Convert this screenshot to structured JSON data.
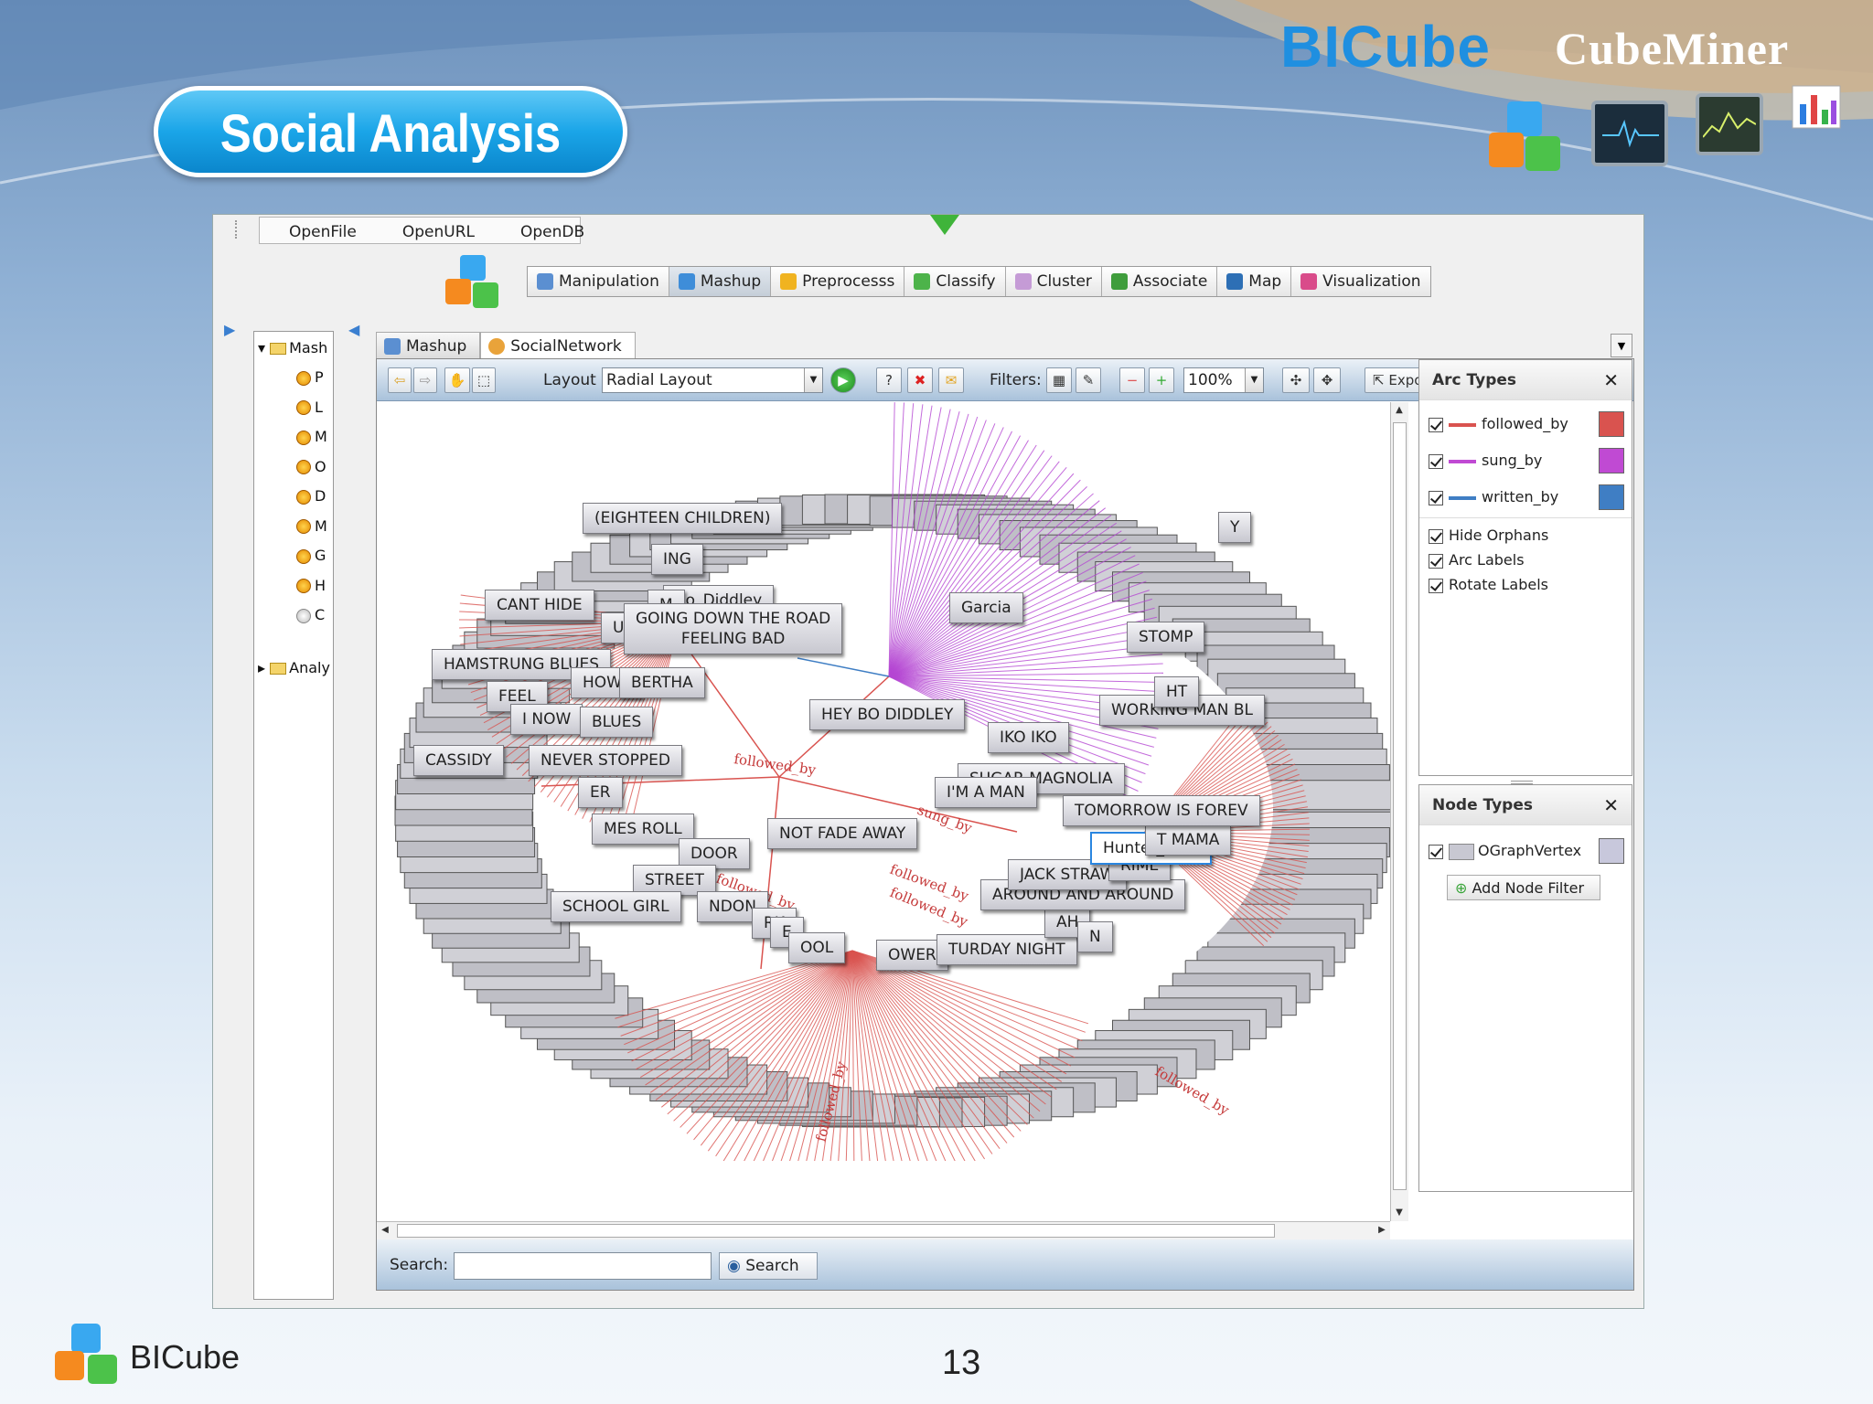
{
  "slide": {
    "brand_main": "BICube",
    "brand_sub": "CubeMiner",
    "title": "Social Analysis",
    "footer_brand": "BICube",
    "page_number": "13"
  },
  "menubar": [
    "OpenFile",
    "OpenURL",
    "OpenDB"
  ],
  "toolbar": [
    {
      "label": "Manipulation",
      "icon": "manipulation-icon",
      "color": "#5b8fd1"
    },
    {
      "label": "Mashup",
      "icon": "mashup-icon",
      "color": "#3e8dd9",
      "active": true
    },
    {
      "label": "Preprocesss",
      "icon": "gear-icon",
      "color": "#f0b320"
    },
    {
      "label": "Classify",
      "icon": "check-icon",
      "color": "#4db34a"
    },
    {
      "label": "Cluster",
      "icon": "cluster-icon",
      "color": "#c59bd6"
    },
    {
      "label": "Associate",
      "icon": "associate-icon",
      "color": "#3f9d3c"
    },
    {
      "label": "Map",
      "icon": "globe-icon",
      "color": "#2d6fb5"
    },
    {
      "label": "Visualization",
      "icon": "bar-chart-icon",
      "color": "#d94b8a"
    }
  ],
  "tree": {
    "root": "Mash",
    "items": [
      "P",
      "L",
      "M",
      "O",
      "D",
      "M",
      "G",
      "H",
      "C"
    ],
    "second_root": "Analy"
  },
  "tabs": [
    {
      "label": "Mashup",
      "icon": "mashup-icon"
    },
    {
      "label": "SocialNetwork",
      "icon": "network-icon"
    }
  ],
  "graph_toolbar": {
    "layout_label": "Layout",
    "layout_value": "Radial Layout",
    "filters_label": "Filters:",
    "zoom_value": "100%",
    "export_label": "Export..."
  },
  "search": {
    "label": "Search:",
    "value": "",
    "button": "Search"
  },
  "arc_types": {
    "title": "Arc Types",
    "items": [
      {
        "label": "followed_by",
        "color": "#d9534f"
      },
      {
        "label": "sung_by",
        "color": "#c04ad3"
      },
      {
        "label": "written_by",
        "color": "#3f7ec4"
      }
    ],
    "options": [
      "Hide Orphans",
      "Arc Labels",
      "Rotate Labels"
    ]
  },
  "node_types": {
    "title": "Node Types",
    "items": [
      {
        "label": "OGraphVertex",
        "color": "#c5c5d8"
      }
    ],
    "add_filter": "Add Node Filter"
  },
  "graph": {
    "nodes": [
      "(EIGHTEEN CHILDREN)",
      "ING",
      "CANT HIDE",
      "UITE",
      "Bo_Diddley",
      "M",
      "GOING DOWN THE ROAD\nFEELING BAD",
      "Garcia",
      "HAMSTRUNG BLUES",
      "HOW I",
      "BERTHA",
      "FEEL",
      "I NOW",
      "BLUES",
      "HEY BO DIDDLEY",
      "IKO IKO",
      "CASSIDY",
      "NEVER STOPPED",
      "SUGAR MAGNOLIA",
      "I'M A MAN",
      "ER",
      "MES ROLL",
      "NOT FADE AWAY",
      "DOOR",
      "STREET",
      "SCHOOL GIRL",
      "NDON",
      "RK",
      "E",
      "OOL",
      "OWER",
      "TURDAY NIGHT",
      "AH",
      "N",
      "AROUND AND AROUND",
      "JACK STRAW",
      "RIME",
      "Hunter_Weir",
      "T MAMA",
      "TOMORROW IS FOREV",
      "WORKING MAN BL",
      "HT",
      "STOMP",
      "Y"
    ],
    "edge_labels": [
      "followed_by",
      "sung_by",
      "followed_by",
      "followed_by",
      "followed_by",
      "followed_by",
      "followed_by"
    ]
  }
}
